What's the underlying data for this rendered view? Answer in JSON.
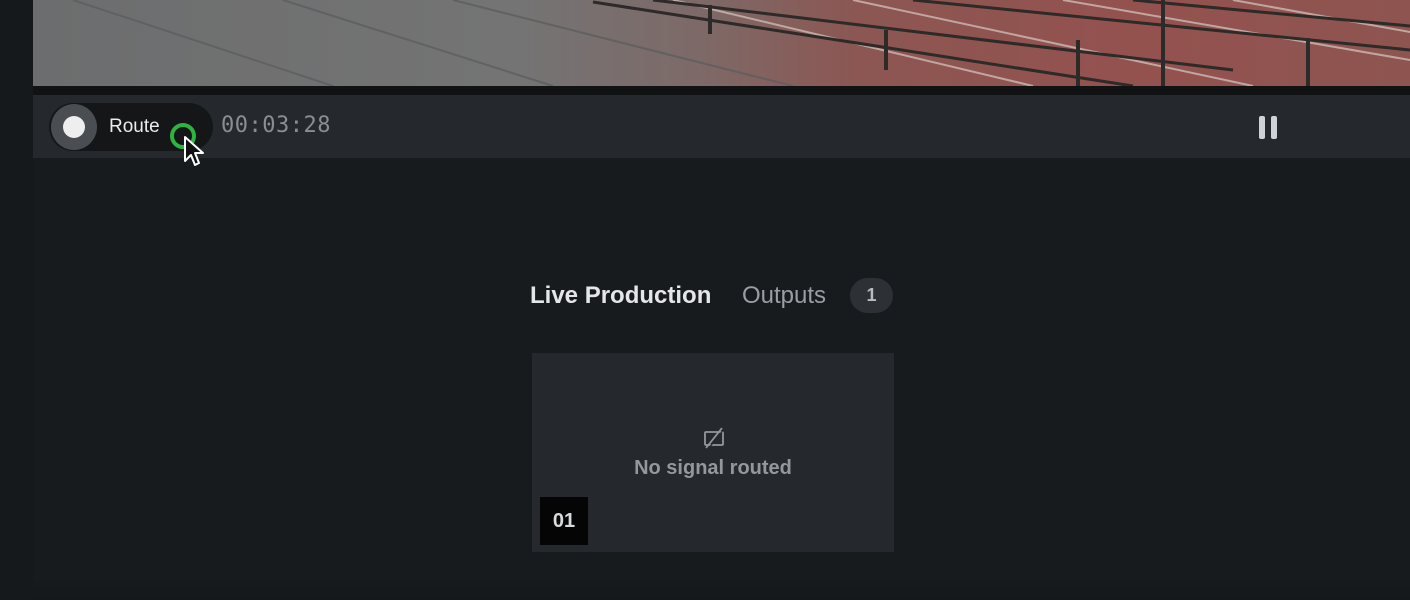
{
  "control_bar": {
    "route_label": "Route",
    "route_toggle_state": "off",
    "timecode": "00:03:28",
    "pause_icon": "pause-icon"
  },
  "tabs": [
    {
      "label": "Live Production",
      "active": true
    },
    {
      "label": "Outputs",
      "active": false,
      "count": "1"
    }
  ],
  "outputs": [
    {
      "number": "01",
      "status": "No signal routed",
      "icon": "no-signal-icon"
    }
  ],
  "colors": {
    "background": "#181b1e",
    "bar": "#25282c",
    "click_indicator": "#2fb33e",
    "card": "#25282c"
  }
}
